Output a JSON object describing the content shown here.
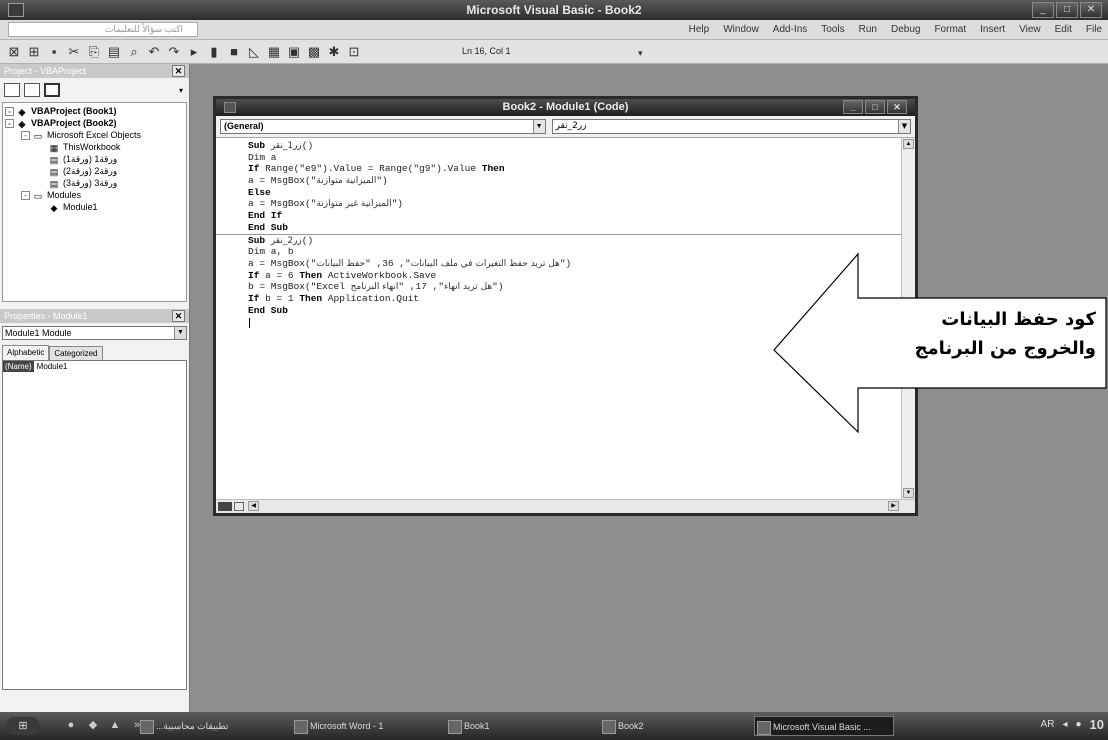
{
  "window": {
    "title": "Microsoft Visual Basic - Book2"
  },
  "menubar": {
    "help_placeholder": "اكتب سؤالاً للتعليمات",
    "items": [
      "Help",
      "Window",
      "Add-Ins",
      "Tools",
      "Run",
      "Debug",
      "Format",
      "Insert",
      "View",
      "Edit",
      "File"
    ]
  },
  "toolbar": {
    "position": "Ln 16, Col 1"
  },
  "project": {
    "title": "Project - VBAProject",
    "tree": [
      {
        "label": "VBAProject (Book1)",
        "bold": true,
        "level": 0,
        "toggle": "-",
        "icon": "vba-project-icon"
      },
      {
        "label": "VBAProject (Book2)",
        "bold": true,
        "level": 0,
        "toggle": "-",
        "icon": "vba-project-icon"
      },
      {
        "label": "Microsoft Excel Objects",
        "bold": false,
        "level": 1,
        "toggle": "-",
        "icon": "folder-icon"
      },
      {
        "label": "ThisWorkbook",
        "bold": false,
        "level": 2,
        "toggle": "",
        "icon": "workbook-icon"
      },
      {
        "label": "ورقة1 (ورقة1)",
        "bold": false,
        "level": 2,
        "toggle": "",
        "icon": "worksheet-icon"
      },
      {
        "label": "ورقة2 (ورقة2)",
        "bold": false,
        "level": 2,
        "toggle": "",
        "icon": "worksheet-icon"
      },
      {
        "label": "ورقة3 (ورقة3)",
        "bold": false,
        "level": 2,
        "toggle": "",
        "icon": "worksheet-icon"
      },
      {
        "label": "Modules",
        "bold": false,
        "level": 1,
        "toggle": "-",
        "icon": "folder-icon"
      },
      {
        "label": "Module1",
        "bold": false,
        "level": 2,
        "toggle": "",
        "icon": "module-icon"
      }
    ]
  },
  "properties": {
    "title": "Properties - Module1",
    "object": "Module1 Module",
    "tabs": [
      "Alphabetic",
      "Categorized"
    ],
    "rows": [
      {
        "name": "(Name)",
        "value": "Module1"
      }
    ]
  },
  "code_window": {
    "title": "Book2 - Module1 (Code)",
    "object_combo": "(General)",
    "proc_combo": "زر2_نقر",
    "lines": [
      {
        "parts": [
          [
            "kw",
            "Sub "
          ],
          [
            "ar",
            "زر1_نقر"
          ],
          [
            "",
            "()"
          ]
        ]
      },
      {
        "parts": [
          [
            "",
            "Dim a"
          ]
        ]
      },
      {
        "parts": [
          [
            "kw",
            "If "
          ],
          [
            "",
            "Range(\"e9\").Value = Range(\"g9\").Value "
          ],
          [
            "kw",
            "Then"
          ]
        ]
      },
      {
        "parts": [
          [
            "",
            "a = MsgBox(\""
          ],
          [
            "ar",
            "الميزانية متوازنة"
          ],
          [
            "",
            "\")"
          ]
        ]
      },
      {
        "parts": [
          [
            "kw",
            "Else"
          ]
        ]
      },
      {
        "parts": [
          [
            "",
            "a = MsgBox(\""
          ],
          [
            "ar",
            "الميزانية غير متوازنة"
          ],
          [
            "",
            "\")"
          ]
        ]
      },
      {
        "parts": [
          [
            "kw",
            "End If"
          ]
        ]
      },
      {
        "parts": [
          [
            "kw",
            "End Sub"
          ]
        ],
        "separator_after": true
      },
      {
        "parts": [
          [
            "kw",
            "Sub "
          ],
          [
            "ar",
            "زر2_نقر"
          ],
          [
            "",
            "()"
          ]
        ]
      },
      {
        "parts": [
          [
            "",
            "Dim a, b"
          ]
        ]
      },
      {
        "parts": [
          [
            "",
            "a = MsgBox(\""
          ],
          [
            "ar",
            "هل تريد حفظ التغيرات في ملف البيانات"
          ],
          [
            "",
            "\", 36, \""
          ],
          [
            "ar",
            "حفظ البيانات"
          ],
          [
            "",
            "\")"
          ]
        ]
      },
      {
        "parts": [
          [
            "kw",
            "If "
          ],
          [
            "",
            "a = 6 "
          ],
          [
            "kw",
            "Then "
          ],
          [
            "",
            "ActiveWorkbook.Save"
          ]
        ]
      },
      {
        "parts": [
          [
            "",
            "b = MsgBox(\"Excel "
          ],
          [
            "ar",
            "هل تريد انهاء"
          ],
          [
            "",
            "\", 17, \""
          ],
          [
            "ar",
            "انهاء البرنامج"
          ],
          [
            "",
            "\")"
          ]
        ]
      },
      {
        "parts": [
          [
            "kw",
            "If "
          ],
          [
            "",
            "b = 1 "
          ],
          [
            "kw",
            "Then "
          ],
          [
            "",
            "Application.Quit"
          ]
        ]
      },
      {
        "parts": [
          [
            "kw",
            "End Sub"
          ]
        ]
      }
    ]
  },
  "callout": {
    "line1": "كود حفظ البيانات",
    "line2": "والخروج من البرنامج"
  },
  "taskbar": {
    "tasks": [
      {
        "label": "...تطبيقات محاسبية",
        "active": false
      },
      {
        "label": "Microsoft Word - 1",
        "active": false
      },
      {
        "label": "Book1",
        "active": false
      },
      {
        "label": "Book2",
        "active": false
      },
      {
        "label": "Microsoft Visual Basic ...",
        "active": true
      }
    ],
    "language": "AR",
    "clock": "10"
  }
}
